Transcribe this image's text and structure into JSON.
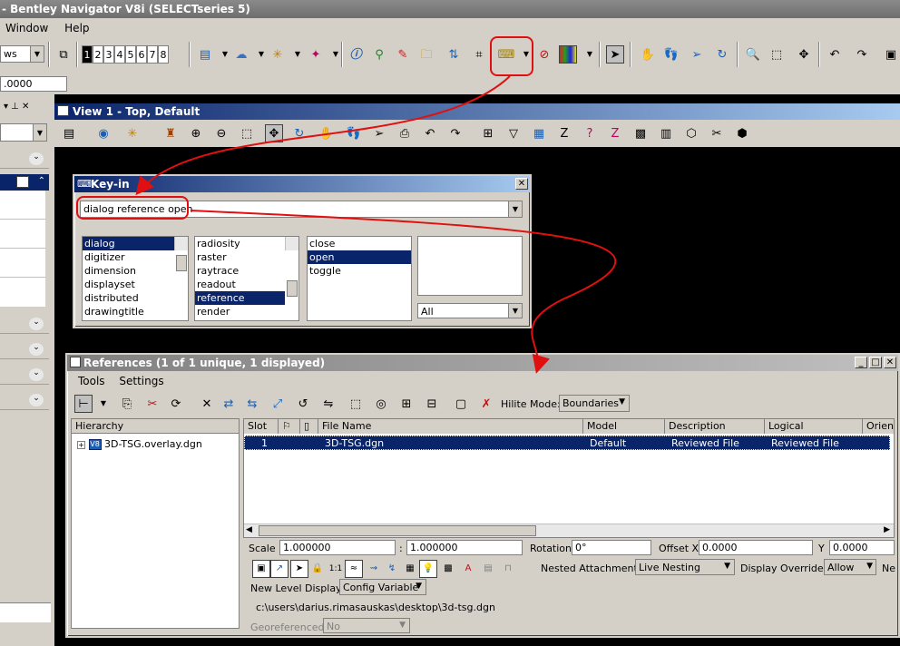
{
  "app_title": "- Bentley Navigator V8i (SELECTseries 5)",
  "menu": [
    "Window",
    "Help"
  ],
  "toolbar": {
    "mode_combo": "ws",
    "view_numbers": [
      "1",
      "2",
      "3",
      "4",
      "5",
      "6",
      "7",
      "8"
    ],
    "coord_value": ".0000"
  },
  "view_title": "View 1 - Top, Default",
  "keyin": {
    "title": "Key-in",
    "input_value": "dialog reference open",
    "list1": [
      "dialog",
      "digitizer",
      "dimension",
      "displayset",
      "distributed",
      "drawingtitle"
    ],
    "list2": [
      "radiosity",
      "raster",
      "raytrace",
      "readout",
      "reference",
      "render"
    ],
    "list3": [
      "close",
      "open",
      "toggle"
    ],
    "filter_value": "All"
  },
  "references": {
    "title": "References (1 of 1 unique, 1 displayed)",
    "menu": [
      "Tools",
      "Settings"
    ],
    "hilite_label": "Hilite Mode:",
    "hilite_value": "Boundaries",
    "hierarchy_label": "Hierarchy",
    "tree_item": "3D-TSG.overlay.dgn",
    "columns": [
      "Slot",
      "",
      "",
      "File Name",
      "Model",
      "Description",
      "Logical",
      "Orien"
    ],
    "rows": [
      {
        "slot": "1",
        "file": "3D-TSG.dgn",
        "model": "Default",
        "description": "Reviewed File",
        "logical": "Reviewed File"
      }
    ],
    "scale_label": "Scale",
    "scale1": "1.000000",
    "colon": ":",
    "scale2": "1.000000",
    "rotation_label": "Rotation",
    "rotation_value": "0°",
    "offset_label": "Offset X",
    "offset_x": "0.0000",
    "y_label": "Y",
    "offset_y": "0.0000",
    "nested_label": "Nested Attachments:",
    "nested_value": "Live Nesting",
    "overrides_label": "Display Overrides:",
    "overrides_value": "Allow",
    "ne_label": "Ne",
    "new_level_label": "New Level Display:",
    "new_level_value": "Config Variable",
    "path": "c:\\users\\darius.rimasauskas\\desktop\\3d-tsg.dgn",
    "georef_label": "Georeferenced:",
    "georef_value": "No"
  },
  "colors": {
    "annotation": "#e01010",
    "selection": "#0a246a",
    "chrome": "#d4d0c8"
  }
}
